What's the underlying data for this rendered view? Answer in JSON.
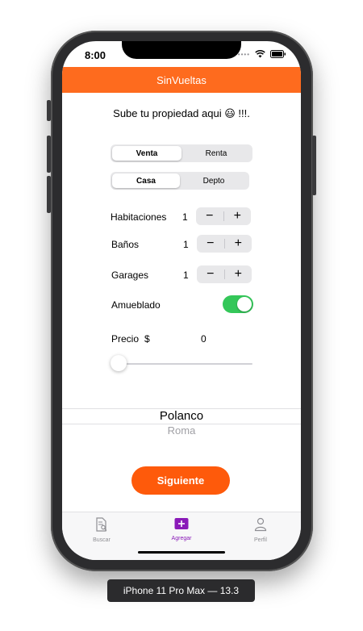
{
  "status_bar": {
    "time": "8:00"
  },
  "navbar": {
    "title": "SinVueltas"
  },
  "headline": {
    "text": "Sube tu propiedad aqui 😃 !!!."
  },
  "operation_segment": {
    "options": [
      "Venta",
      "Renta"
    ],
    "selected": "Venta"
  },
  "type_segment": {
    "options": [
      "Casa",
      "Depto"
    ],
    "selected": "Casa"
  },
  "rows": {
    "habitaciones": {
      "label": "Habitaciones",
      "value": "1"
    },
    "banos": {
      "label": "Baños",
      "value": "1"
    },
    "garages": {
      "label": "Garages",
      "value": "1"
    },
    "amueblado": {
      "label": "Amueblado",
      "on": true
    }
  },
  "stepper": {
    "minus": "−",
    "plus": "+"
  },
  "price": {
    "label": "Precio",
    "currency": "$",
    "value": "0",
    "slider_fraction": 0
  },
  "picker": {
    "selected": "Polanco",
    "next": "Roma"
  },
  "cta": {
    "label": "Siguiente"
  },
  "tabbar": {
    "items": [
      {
        "label": "Buscar",
        "icon": "document-search-icon"
      },
      {
        "label": "Agregar",
        "icon": "plus-square-icon",
        "active": true
      },
      {
        "label": "Perfil",
        "icon": "person-icon"
      }
    ]
  },
  "device": {
    "label": "iPhone 11 Pro Max — 13.3"
  },
  "colors": {
    "accent": "#fe6b1e",
    "cta": "#fe5a0b",
    "toggle_on": "#34c759",
    "tab_active": "#8a1ab8"
  }
}
